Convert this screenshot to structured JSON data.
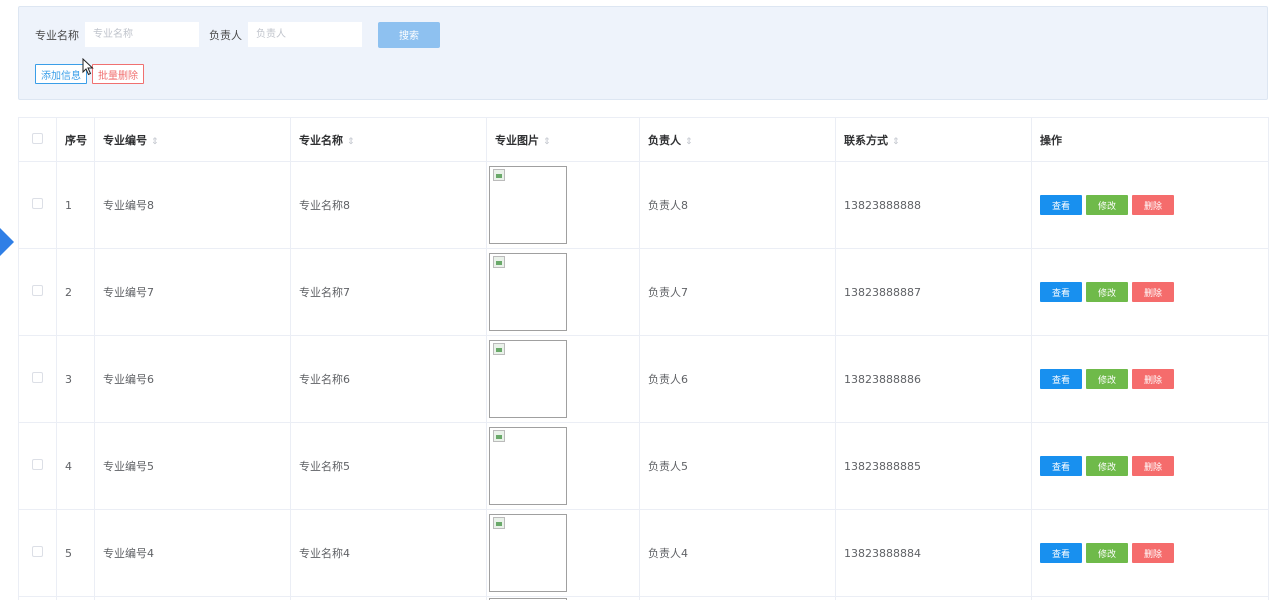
{
  "search": {
    "major_name_label": "专业名称",
    "major_name_placeholder": "专业名称",
    "major_name_value": "",
    "leader_label": "负责人",
    "leader_placeholder": "负责人",
    "leader_value": "",
    "search_button": "搜索"
  },
  "actions": {
    "add_button": "添加信息",
    "batch_delete_button": "批量删除"
  },
  "table": {
    "headers": {
      "index": "序号",
      "code": "专业编号",
      "name": "专业名称",
      "image": "专业图片",
      "leader": "负责人",
      "contact": "联系方式",
      "ops": "操作"
    },
    "sort_icon": "⇕",
    "row_buttons": {
      "view": "查看",
      "edit": "修改",
      "delete": "删除"
    },
    "rows": [
      {
        "index": "1",
        "code": "专业编号8",
        "name": "专业名称8",
        "leader": "负责人8",
        "contact": "13823888888"
      },
      {
        "index": "2",
        "code": "专业编号7",
        "name": "专业名称7",
        "leader": "负责人7",
        "contact": "13823888887"
      },
      {
        "index": "3",
        "code": "专业编号6",
        "name": "专业名称6",
        "leader": "负责人6",
        "contact": "13823888886"
      },
      {
        "index": "4",
        "code": "专业编号5",
        "name": "专业名称5",
        "leader": "负责人5",
        "contact": "13823888885"
      },
      {
        "index": "5",
        "code": "专业编号4",
        "name": "专业名称4",
        "leader": "负责人4",
        "contact": "13823888884"
      }
    ]
  },
  "colors": {
    "primary": "#1890ef",
    "success": "#6fba4a",
    "danger": "#f56c6c",
    "panel_bg": "#eef3fb"
  }
}
